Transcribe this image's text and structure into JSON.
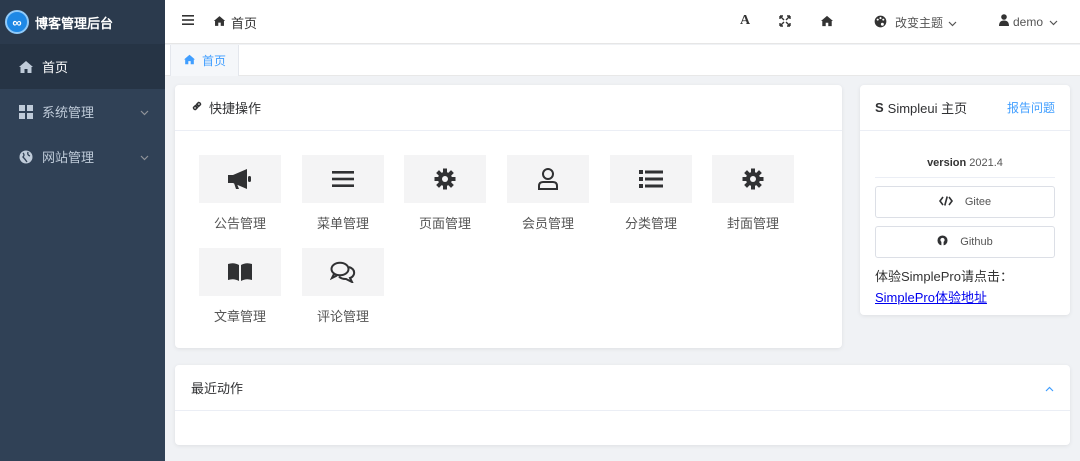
{
  "app": {
    "title": "博客管理后台",
    "logo_glyph": "∞"
  },
  "sidebar": {
    "items": [
      {
        "label": "首页",
        "icon": "home-icon"
      },
      {
        "label": "系统管理",
        "icon": "grid-icon",
        "arrow": "chevron-down-icon"
      },
      {
        "label": "网站管理",
        "icon": "globe-icon",
        "arrow": "chevron-down-icon"
      }
    ]
  },
  "header": {
    "breadcrumb": "首页",
    "theme_label": "改变主题",
    "user_label": "demo",
    "font_glyph": "A"
  },
  "tabs": [
    {
      "label": "首页"
    }
  ],
  "quick": {
    "title": "快捷操作",
    "items": [
      {
        "label": "公告管理",
        "icon": "megaphone-icon"
      },
      {
        "label": "菜单管理",
        "icon": "menu-bars-icon"
      },
      {
        "label": "页面管理",
        "icon": "gear-icon"
      },
      {
        "label": "会员管理",
        "icon": "user-icon"
      },
      {
        "label": "分类管理",
        "icon": "list-icon"
      },
      {
        "label": "封面管理",
        "icon": "gear-icon"
      },
      {
        "label": "文章管理",
        "icon": "book-icon"
      },
      {
        "label": "评论管理",
        "icon": "comments-icon"
      }
    ]
  },
  "home_card": {
    "title_prefix": "S",
    "title": "Simpleui 主页",
    "report": "报告问题",
    "version_label": "version",
    "version_value": "2021.4",
    "gitee_label": "Gitee",
    "github_label": "Github",
    "try_text": "体验SimplePro请点击：",
    "try_link": "SimplePro体验地址"
  },
  "recent": {
    "title": "最近动作"
  },
  "colors": {
    "sidebar_bg": "#304156",
    "accent": "#409eff",
    "icon_dark": "#303133"
  }
}
